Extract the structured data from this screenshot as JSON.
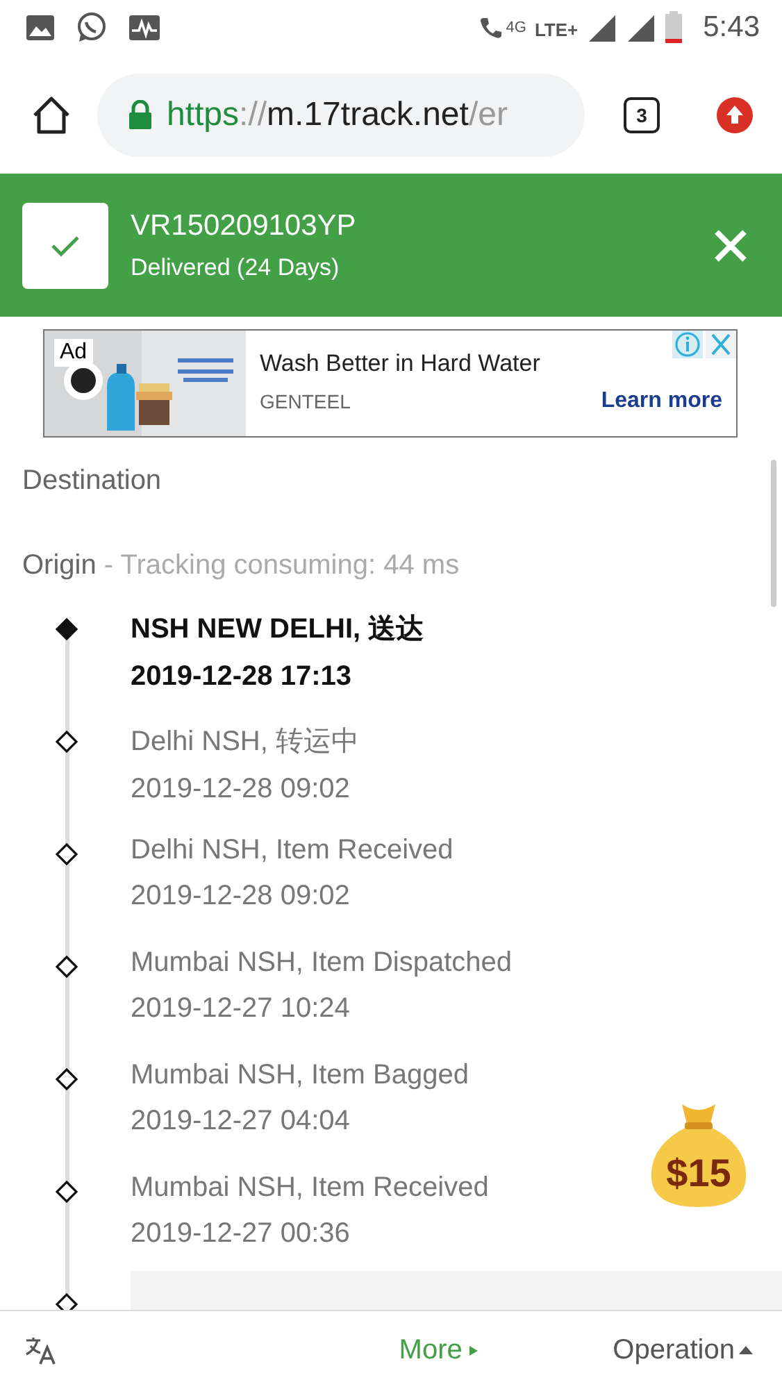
{
  "status_bar": {
    "network": "4G",
    "network_type": "LTE+",
    "time": "5:43"
  },
  "browser": {
    "url_scheme": "https",
    "url_sep": "://",
    "url_host": "m.17track.net",
    "url_rest": "/er",
    "tab_count": "3"
  },
  "banner": {
    "tracking_number": "VR150209103YP",
    "status": "Delivered (24 Days)"
  },
  "ad": {
    "badge": "Ad",
    "title": "Wash Better in Hard Water",
    "advertiser": "GENTEEL",
    "cta": "Learn more"
  },
  "destination": {
    "label": "Destination"
  },
  "origin": {
    "label": "Origin",
    "separator": " - ",
    "note": "Tracking consuming: 44 ms"
  },
  "events": [
    {
      "place": "NSH NEW DELHI, 送达",
      "time": "2019-12-28 17:13",
      "current": true
    },
    {
      "place": "Delhi NSH, 转运中",
      "time": "2019-12-28 09:02",
      "current": false
    },
    {
      "place": "Delhi NSH, Item Received",
      "time": "2019-12-28 09:02",
      "current": false
    },
    {
      "place": "Mumbai NSH, Item Dispatched",
      "time": "2019-12-27 10:24",
      "current": false
    },
    {
      "place": "Mumbai NSH, Item Bagged",
      "time": "2019-12-27 04:04",
      "current": false
    },
    {
      "place": "Mumbai NSH, Item Received",
      "time": "2019-12-27 00:36",
      "current": false
    }
  ],
  "reward": {
    "amount": "$15"
  },
  "bottom_bar": {
    "more": "More",
    "operation": "Operation"
  }
}
